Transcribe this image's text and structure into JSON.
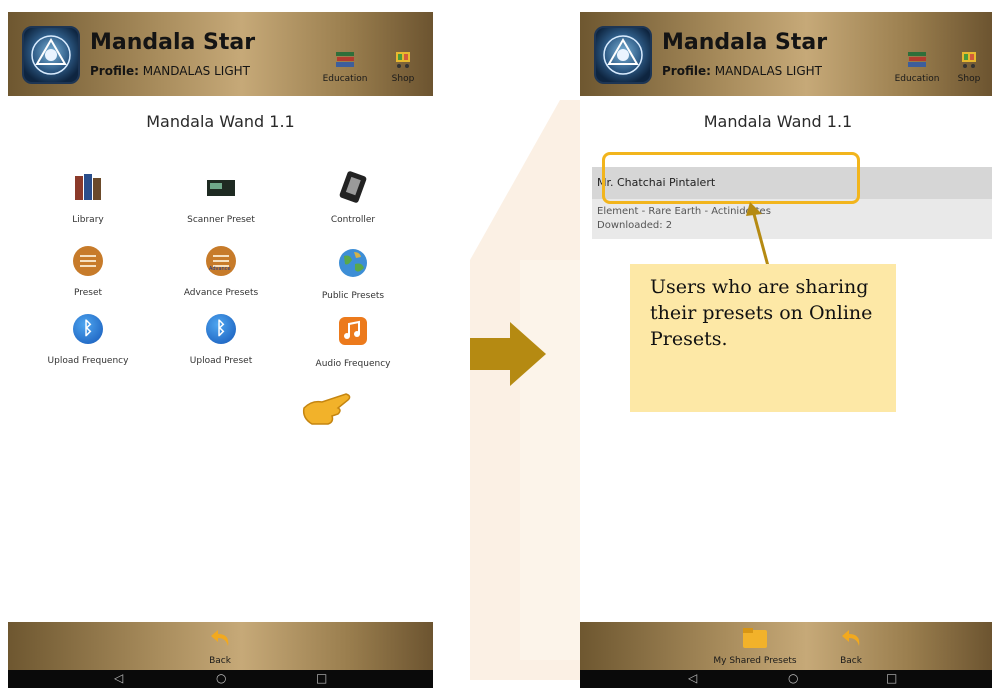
{
  "left_screen": {
    "app_title": "Mandala Star",
    "profile_label": "Profile:",
    "profile_name": "MANDALAS LIGHT",
    "education": "Education",
    "shop": "Shop",
    "screen_title": "Mandala Wand 1.1",
    "menu": [
      {
        "label": "Library",
        "icon": "books-icon"
      },
      {
        "label": "Scanner Preset",
        "icon": "scanner-device-icon"
      },
      {
        "label": "Controller",
        "icon": "controller-device-icon"
      },
      {
        "label": "Preset",
        "icon": "sliders-icon"
      },
      {
        "label": "Advance Presets",
        "icon": "sliders-icon"
      },
      {
        "label": "Public Presets",
        "icon": "globe-icon"
      },
      {
        "label": "Upload Frequency",
        "icon": "bluetooth-icon"
      },
      {
        "label": "Upload Preset",
        "icon": "bluetooth-icon"
      },
      {
        "label": "Audio Frequency",
        "icon": "music-note-icon"
      }
    ],
    "advance_badge": "Advance",
    "back": "Back"
  },
  "right_screen": {
    "app_title": "Mandala Star",
    "profile_label": "Profile:",
    "profile_name": "MANDALAS LIGHT",
    "education": "Education",
    "shop": "Shop",
    "screen_title": "Mandala Wand 1.1",
    "user_name": "Mr. Chatchai Pintalert",
    "preset_name": "Element - Rare Earth - Actinidettes",
    "downloaded": "Downloaded: 2",
    "my_shared_presets": "My Shared Presets",
    "back": "Back"
  },
  "callout": {
    "text": "Users who are sharing their presets on Online Presets."
  },
  "colors": {
    "header_gold": "#a88c5c",
    "arrow": "#b58a12",
    "highlight": "#f2b51d",
    "callout_bg": "#fde8a6"
  }
}
